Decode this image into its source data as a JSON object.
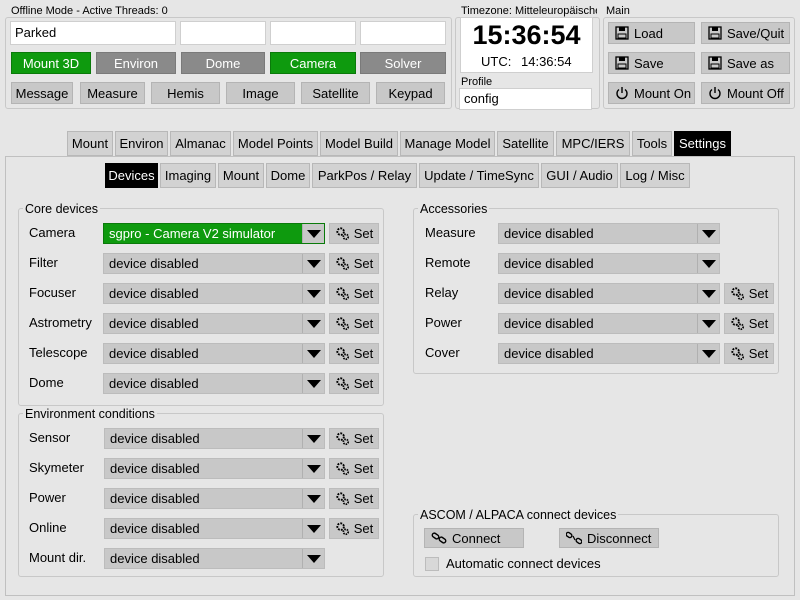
{
  "header": {
    "status_line": "Offline Mode  -  Active Threads:  0",
    "status_field": "Parked",
    "mode_buttons": [
      "Mount 3D",
      "Environ",
      "Dome",
      "Camera",
      "Solver"
    ],
    "action_buttons": [
      "Message",
      "Measure",
      "Hemis",
      "Image",
      "Satellite",
      "Keypad"
    ],
    "timezone_label": "Timezone: Mitteleuropäische",
    "clock_time": "15:36:54",
    "utc_label": "UTC:",
    "utc_time": "14:36:54",
    "profile_label": "Profile",
    "profile_value": "config",
    "main_label": "Main",
    "main_buttons": [
      "Load",
      "Save/Quit",
      "Save",
      "Save as",
      "Mount On",
      "Mount Off"
    ]
  },
  "tabs": [
    "Mount",
    "Environ",
    "Almanac",
    "Model Points",
    "Model Build",
    "Manage Model",
    "Satellite",
    "MPC/IERS",
    "Tools",
    "Settings"
  ],
  "subtabs": [
    "Devices",
    "Imaging",
    "Mount",
    "Dome",
    "ParkPos / Relay",
    "Update / TimeSync",
    "GUI / Audio",
    "Log / Misc"
  ],
  "core_devices": {
    "title": "Core devices",
    "rows": [
      {
        "label": "Camera",
        "value": "sgpro - Camera V2 simulator",
        "set": "Set"
      },
      {
        "label": "Filter",
        "value": "device disabled",
        "set": "Set"
      },
      {
        "label": "Focuser",
        "value": "device disabled",
        "set": "Set"
      },
      {
        "label": "Astrometry",
        "value": "device disabled",
        "set": "Set"
      },
      {
        "label": "Telescope",
        "value": "device disabled",
        "set": "Set"
      },
      {
        "label": "Dome",
        "value": "device disabled",
        "set": "Set"
      }
    ]
  },
  "environment": {
    "title": "Environment conditions",
    "rows": [
      {
        "label": "Sensor",
        "value": "device disabled",
        "set": "Set"
      },
      {
        "label": "Skymeter",
        "value": "device disabled",
        "set": "Set"
      },
      {
        "label": "Power",
        "value": "device disabled",
        "set": "Set"
      },
      {
        "label": "Online",
        "value": "device disabled",
        "set": "Set"
      },
      {
        "label": "Mount dir.",
        "value": "device disabled"
      }
    ]
  },
  "accessories": {
    "title": "Accessories",
    "rows": [
      {
        "label": "Measure",
        "value": "device disabled"
      },
      {
        "label": "Remote",
        "value": "device disabled"
      },
      {
        "label": "Relay",
        "value": "device disabled",
        "set": "Set"
      },
      {
        "label": "Power",
        "value": "device disabled",
        "set": "Set"
      },
      {
        "label": "Cover",
        "value": "device disabled",
        "set": "Set"
      }
    ]
  },
  "ascom": {
    "title": "ASCOM / ALPACA connect devices",
    "connect": "Connect",
    "disconnect": "Disconnect",
    "auto_connect": "Automatic connect devices"
  },
  "colors": {
    "active_green": "#0e9a0e",
    "inactive_grey": "#8a8a8a",
    "active_tab": "#000000"
  }
}
